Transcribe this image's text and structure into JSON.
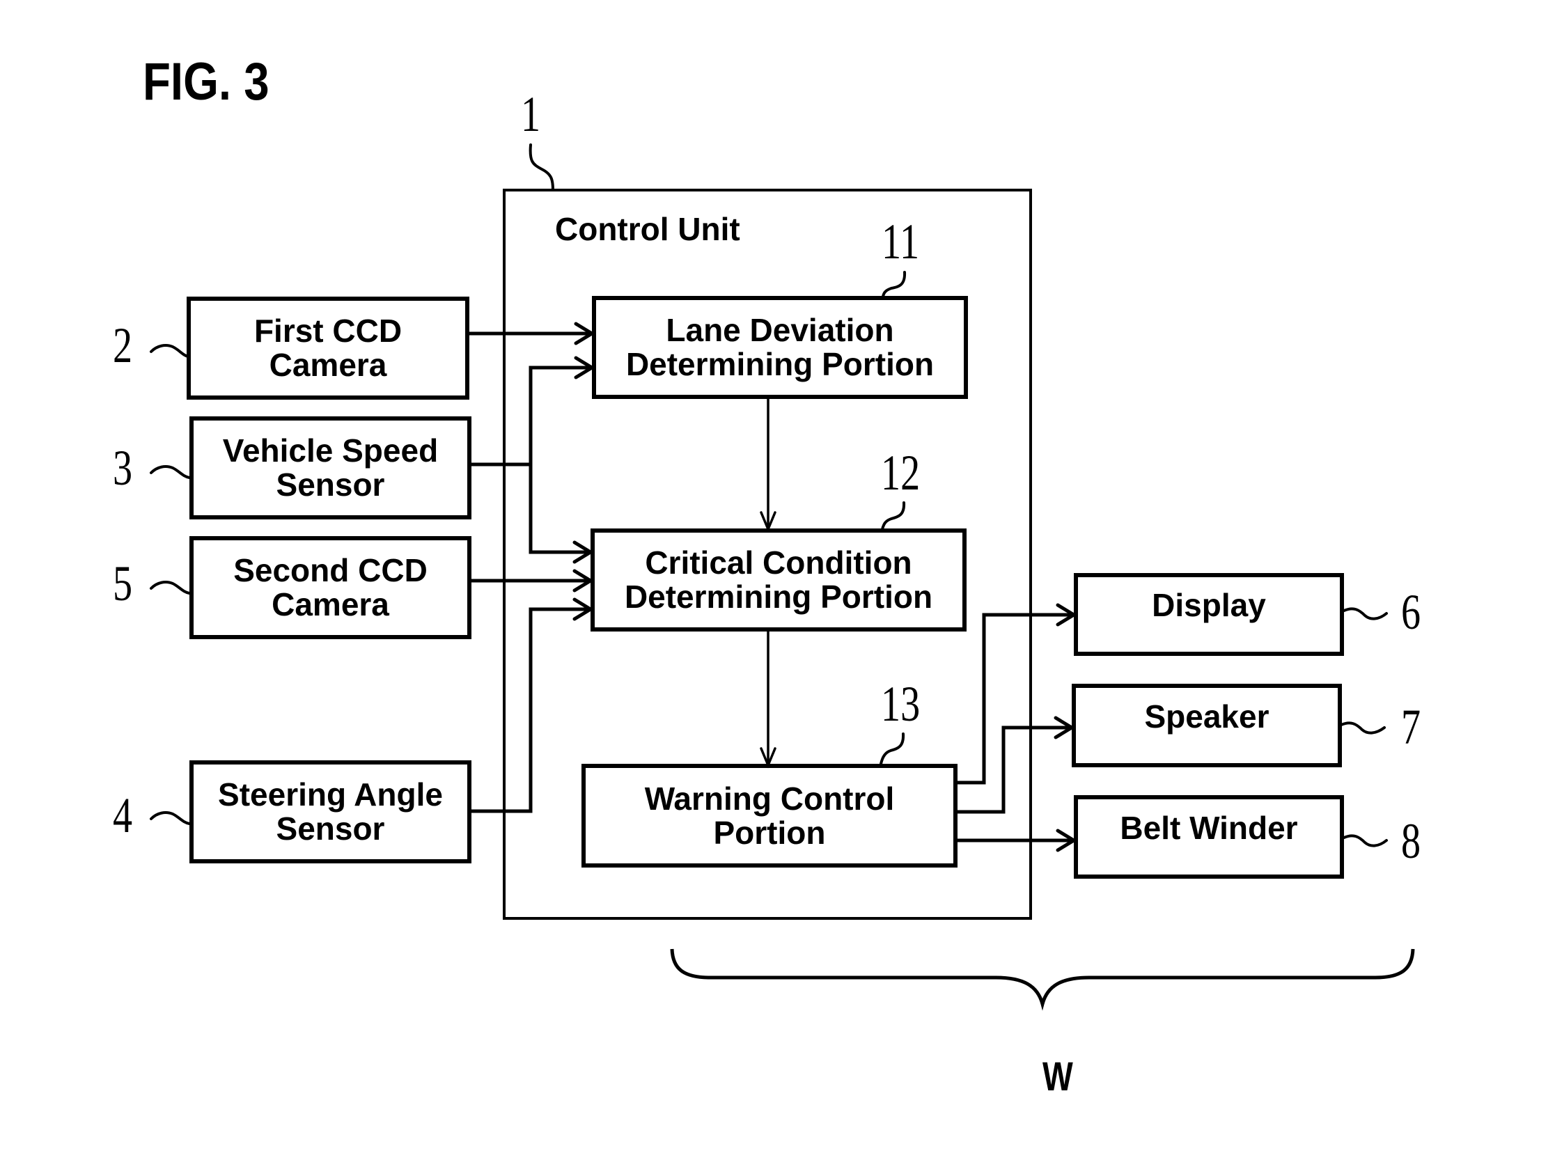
{
  "figure": {
    "title": "FIG. 3",
    "group_label": "W"
  },
  "control_unit": {
    "ref": "1",
    "label": "Control Unit",
    "portions": [
      {
        "ref": "11",
        "lines": [
          "Lane Deviation",
          "Determining Portion"
        ]
      },
      {
        "ref": "12",
        "lines": [
          "Critical Condition",
          "Determining Portion"
        ]
      },
      {
        "ref": "13",
        "lines": [
          "Warning Control",
          "Portion"
        ]
      }
    ]
  },
  "inputs": [
    {
      "ref": "2",
      "lines": [
        "First CCD",
        "Camera"
      ]
    },
    {
      "ref": "3",
      "lines": [
        "Vehicle Speed",
        "Sensor"
      ]
    },
    {
      "ref": "5",
      "lines": [
        "Second CCD",
        "Camera"
      ]
    },
    {
      "ref": "4",
      "lines": [
        "Steering Angle",
        "Sensor"
      ]
    }
  ],
  "outputs": [
    {
      "ref": "6",
      "label": "Display"
    },
    {
      "ref": "7",
      "label": "Speaker"
    },
    {
      "ref": "8",
      "label": "Belt Winder"
    }
  ],
  "connections": [
    {
      "from": "First CCD Camera",
      "to": "Lane Deviation Determining Portion"
    },
    {
      "from": "Vehicle Speed Sensor",
      "to": "Lane Deviation Determining Portion"
    },
    {
      "from": "Vehicle Speed Sensor",
      "to": "Critical Condition Determining Portion"
    },
    {
      "from": "Second CCD Camera",
      "to": "Critical Condition Determining Portion"
    },
    {
      "from": "Steering Angle Sensor",
      "to": "Critical Condition Determining Portion"
    },
    {
      "from": "Lane Deviation Determining Portion",
      "to": "Critical Condition Determining Portion"
    },
    {
      "from": "Critical Condition Determining Portion",
      "to": "Warning Control Portion"
    },
    {
      "from": "Warning Control Portion",
      "to": "Display"
    },
    {
      "from": "Warning Control Portion",
      "to": "Speaker"
    },
    {
      "from": "Warning Control Portion",
      "to": "Belt Winder"
    }
  ]
}
